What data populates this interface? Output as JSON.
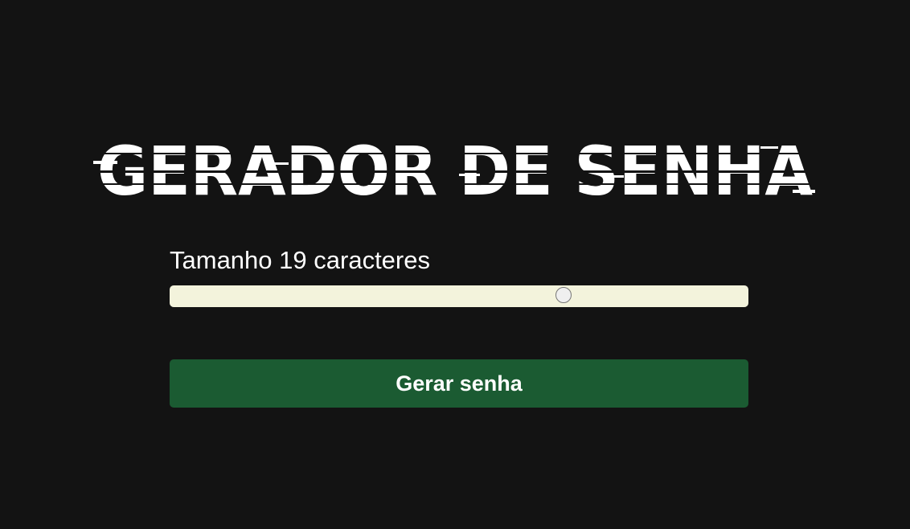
{
  "title": "GERADOR DE SENHA",
  "length_label": {
    "prefix": "Tamanho",
    "value": "19",
    "suffix": "caracteres"
  },
  "slider": {
    "value": 19,
    "min": 8,
    "max": 24
  },
  "button": {
    "label": "Gerar senha"
  },
  "colors": {
    "background": "#131313",
    "text": "#ffffff",
    "slider_track": "#f3f3dc",
    "button": "#1b5b32"
  }
}
